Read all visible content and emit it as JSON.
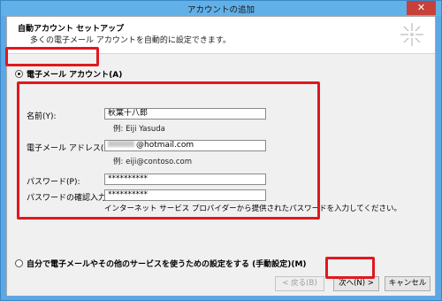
{
  "window": {
    "title": "アカウントの追加",
    "close_label": "✕"
  },
  "header": {
    "title": "自動アカウント セットアップ",
    "subtitle": "多くの電子メール アカウントを自動的に設定できます。"
  },
  "options": {
    "email_account": "電子メール アカウント(A)",
    "manual": "自分で電子メールやその他のサービスを使うための設定をする (手動設定)(M)"
  },
  "fields": {
    "name_label": "名前(Y):",
    "name_value": "秋葉十八郎",
    "name_hint": "例: Eiji Yasuda",
    "email_label": "電子メール アドレス(E):",
    "email_value_visible": "@hotmail.com",
    "email_hint": "例: eiji@contoso.com",
    "password_label": "パスワード(P):",
    "password_value": "**********",
    "confirm_label": "パスワードの確認入力(T):",
    "confirm_value": "**********",
    "note": "インターネット サービス プロバイダーから提供されたパスワードを入力してください。"
  },
  "buttons": {
    "back": "< 戻る(B)",
    "next": "次へ(N) >",
    "cancel": "キャンセル"
  },
  "colors": {
    "title_bar": "#62b0e8",
    "close": "#c7403a",
    "highlight": "#e0181e"
  }
}
